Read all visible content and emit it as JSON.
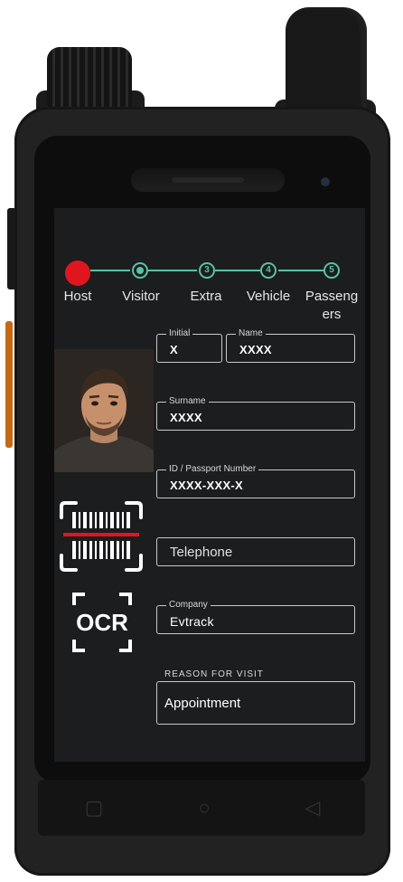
{
  "stepper": {
    "steps": [
      {
        "label": "Host",
        "number": "",
        "state": "active"
      },
      {
        "label": "Visitor",
        "number": "",
        "state": "done"
      },
      {
        "label": "Extra",
        "number": "3",
        "state": "pending"
      },
      {
        "label": "Vehicle",
        "number": "4",
        "state": "pending"
      },
      {
        "label": "Passeng\ners",
        "number": "5",
        "state": "pending"
      }
    ]
  },
  "form": {
    "initial": {
      "label": "Initial",
      "value": "X"
    },
    "name": {
      "label": "Name",
      "value": "XXXX"
    },
    "surname": {
      "label": "Surname",
      "value": "XXXX"
    },
    "id_number": {
      "label": "ID / Passport Number",
      "value": "XXXX-XXX-X"
    },
    "telephone": {
      "placeholder": "Telephone"
    },
    "company": {
      "label": "Company",
      "value": "Evtrack"
    },
    "reason": {
      "label": "REASON FOR VISIT",
      "value": "Appointment"
    }
  },
  "icons": {
    "barcode": "barcode-scan-icon",
    "ocr": "OCR"
  },
  "colors": {
    "accent": "#58c2a6",
    "active_step": "#e0161e",
    "screen_bg": "#1c1d1f",
    "scan_line": "#e0161e"
  }
}
